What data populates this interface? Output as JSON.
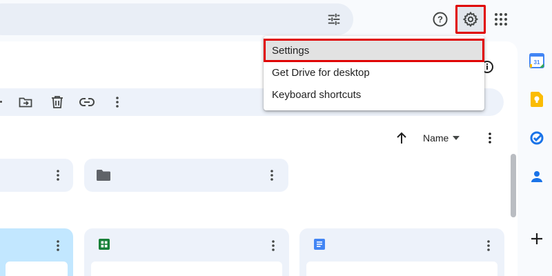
{
  "header": {
    "search_filter_icon": "tune-icon",
    "help_icon": "help-circle-icon",
    "settings_icon": "gear-icon",
    "apps_icon": "apps-grid-icon"
  },
  "settings_menu": {
    "items": [
      {
        "label": "Settings",
        "highlighted": true
      },
      {
        "label": "Get Drive for desktop"
      },
      {
        "label": "Keyboard shortcuts"
      }
    ]
  },
  "toolbar": {
    "icons": [
      "move-to-folder-icon",
      "trash-icon",
      "link-icon",
      "more-vert-icon"
    ]
  },
  "sort": {
    "label": "Name",
    "direction_icon": "arrow-up-icon"
  },
  "side_panel": {
    "apps": [
      "calendar-icon",
      "keep-icon",
      "tasks-icon",
      "contacts-icon",
      "add-icon"
    ],
    "calendar_day": "31"
  },
  "colors": {
    "highlight_border": "#e00000",
    "sheets_green": "#188038",
    "docs_blue": "#4285f4",
    "selected_card": "#c2e7ff"
  }
}
